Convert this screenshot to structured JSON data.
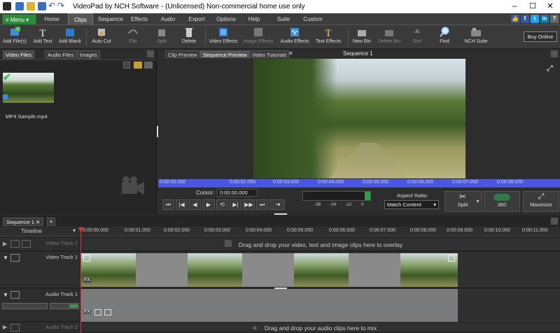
{
  "window": {
    "title": "VideoPad by NCH Software - (Unlicensed) Non-commercial home use only"
  },
  "menu": {
    "menu_label": "≡ Menu ▾",
    "tabs": [
      "Home",
      "Clips",
      "Sequence",
      "Effects",
      "Audio",
      "Export",
      "Options",
      "Help",
      "Suite",
      "Custom"
    ],
    "active_tab": "Clips"
  },
  "toolbar": {
    "items": [
      {
        "label": "Add File(s)",
        "enabled": true
      },
      {
        "label": "Add Text",
        "enabled": true
      },
      {
        "label": "Add Blank",
        "enabled": true
      },
      {
        "label": "Auto Cut",
        "enabled": true
      },
      {
        "label": "Flip",
        "enabled": false
      },
      {
        "label": "Split",
        "enabled": false
      },
      {
        "label": "Delete",
        "enabled": true
      },
      {
        "label": "Video Effects",
        "enabled": true
      },
      {
        "label": "Image Effects",
        "enabled": false
      },
      {
        "label": "Audio Effects",
        "enabled": true
      },
      {
        "label": "Text Effects",
        "enabled": true
      },
      {
        "label": "New Bin",
        "enabled": true
      },
      {
        "label": "Delete Bin",
        "enabled": false
      },
      {
        "label": "Sort",
        "enabled": false
      },
      {
        "label": "Find",
        "enabled": true
      },
      {
        "label": "NCH Suite",
        "enabled": true
      }
    ],
    "buy_online": "Buy Online"
  },
  "bins": {
    "tabs": [
      "Video Files",
      "Audio Files",
      "Images"
    ],
    "active_tab": "Video Files",
    "file_name": "MP4 Sample.mp4"
  },
  "preview": {
    "tabs": [
      "Clip Preview",
      "Sequence Preview",
      "Video Tutorials"
    ],
    "active_tab": "Sequence Preview",
    "sequence_title": "Sequence 1",
    "scrub_ticks": [
      "0:00:00.000",
      "0:00:02.000",
      "0:00:03.000",
      "0:00:04.000",
      "0:00:05.000",
      "0:00:06.000",
      "0:00:07.000",
      "0:00:08.000"
    ],
    "cursor_label": "Cursor:",
    "cursor_value": "0:00:00.000",
    "meter_ticks": [
      "-36",
      "-24",
      "-12",
      "0"
    ],
    "aspect_label": "Aspect Ratio:",
    "aspect_value": "Match Content",
    "split_label": "Split",
    "btn_360_label": "360",
    "maximize_label": "Maximize"
  },
  "timeline": {
    "sequence_tab": "Sequence 1",
    "add_tab": "+",
    "ruler_label": "Timeline",
    "ruler_ticks": [
      "0:00:00.000",
      "0:00:01.000",
      "0:00:02.000",
      "0:00:03.000",
      "0:00:04.000",
      "0:00:05.000",
      "0:00:06.000",
      "0:00:07.000",
      "0:00:08.000",
      "0:00:09.000",
      "0:00:10.000",
      "0:00:11.000"
    ],
    "tracks": {
      "video2": "Video Track 2",
      "video1": "Video Track 1",
      "audio1": "Audio Track 1",
      "audio2": "Audio Track 2"
    },
    "video_drop_hint": "Drag and drop your video, text and image clips here to overlay",
    "audio_drop_hint": "Drag and drop your audio clips here to mix",
    "fx_label": "FX"
  },
  "colors": {
    "accent_green": "#2e8b3d",
    "scrub_blue": "#4a56e0",
    "playhead_red": "#dd3333"
  }
}
